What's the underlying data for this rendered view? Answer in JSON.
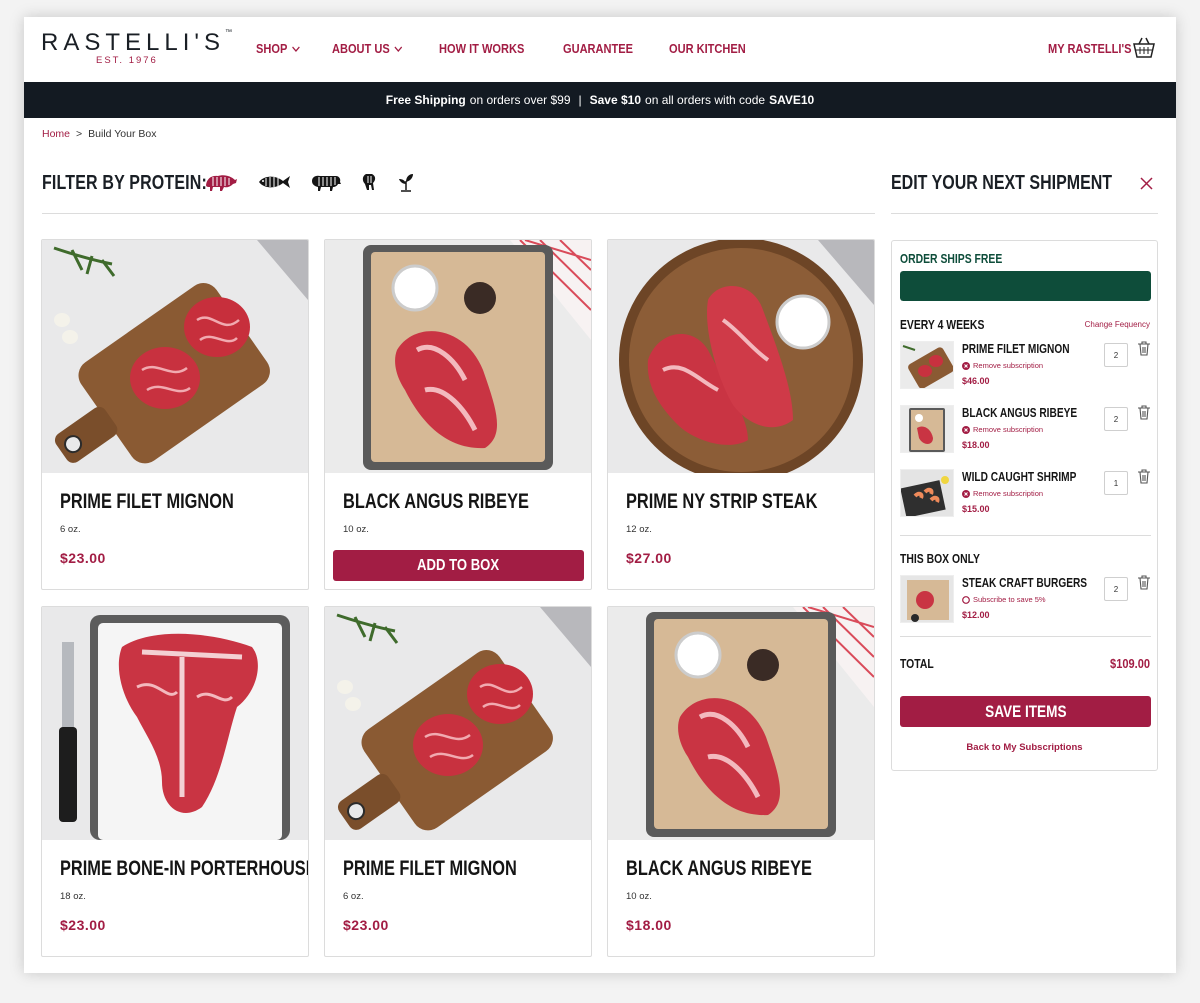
{
  "brand": {
    "name": "RASTELLI'S",
    "tm": "™",
    "est": "EST. 1976"
  },
  "nav": [
    {
      "label": "SHOP",
      "dropdown": true
    },
    {
      "label": "ABOUT US",
      "dropdown": true
    },
    {
      "label": "HOW IT WORKS",
      "dropdown": false
    },
    {
      "label": "GUARANTEE",
      "dropdown": false
    },
    {
      "label": "OUR KITCHEN",
      "dropdown": false
    }
  ],
  "account": {
    "label": "MY RASTELLI'S",
    "cart_icon": "basket-icon"
  },
  "promo": {
    "part1_bold": "Free Shipping",
    "part1": "on orders over $99",
    "sep": "|",
    "part2_bold": "Save $10",
    "part2": "on all orders with code",
    "code": "SAVE10"
  },
  "breadcrumb": {
    "home": "Home",
    "sep": ">",
    "current": "Build Your Box"
  },
  "filter": {
    "title": "FILTER BY PROTEIN:",
    "icons": [
      "beef-icon",
      "fish-icon",
      "pork-icon",
      "poultry-icon",
      "plant-icon"
    ],
    "active": "beef-icon"
  },
  "products": [
    {
      "name": "PRIME FILET MIGNON",
      "size": "6 oz.",
      "price": "$23.00",
      "image": "filet-board"
    },
    {
      "name": "BLACK ANGUS RIBEYE",
      "size": "10 oz.",
      "price": "$18.00",
      "image": "ribeye-tray",
      "button": "ADD TO BOX"
    },
    {
      "name": "PRIME NY STRIP STEAK",
      "size": "12 oz.",
      "price": "$27.00",
      "image": "strip-round"
    },
    {
      "name": "PRIME BONE-IN PORTERHOUSE",
      "size": "18 oz.",
      "price": "$23.00",
      "image": "porterhouse-tray"
    },
    {
      "name": "PRIME FILET MIGNON",
      "size": "6 oz.",
      "price": "$23.00",
      "image": "filet-board"
    },
    {
      "name": "BLACK ANGUS RIBEYE",
      "size": "10 oz.",
      "price": "$18.00",
      "image": "ribeye-tray"
    }
  ],
  "shipment": {
    "title": "EDIT YOUR NEXT SHIPMENT",
    "ships_free": "ORDER SHIPS FREE",
    "progress": 1.0,
    "frequency_label": "EVERY 4 WEEKS",
    "change_frequency": "Change Fequency",
    "subscription_items": [
      {
        "name": "PRIME FILET MIGNON",
        "action": "Remove subscription",
        "price": "$46.00",
        "qty": "2",
        "thumb": "filet-board"
      },
      {
        "name": "BLACK ANGUS RIBEYE",
        "action": "Remove subscription",
        "price": "$18.00",
        "qty": "2",
        "thumb": "ribeye-tray"
      },
      {
        "name": "WILD CAUGHT SHRIMP",
        "action": "Remove subscription",
        "price": "$15.00",
        "qty": "1",
        "thumb": "shrimp"
      }
    ],
    "one_time_label": "THIS BOX ONLY",
    "one_time_items": [
      {
        "name": "STEAK CRAFT BURGERS",
        "action": "Subscribe to save 5%",
        "price": "$12.00",
        "qty": "2",
        "thumb": "burger"
      }
    ],
    "total_label": "TOTAL",
    "total_value": "$109.00",
    "save_label": "SAVE ITEMS",
    "back_label": "Back to My Subscriptions"
  },
  "colors": {
    "brand": "#a21d44",
    "dark": "#131a22",
    "green": "#0e4d3a"
  }
}
